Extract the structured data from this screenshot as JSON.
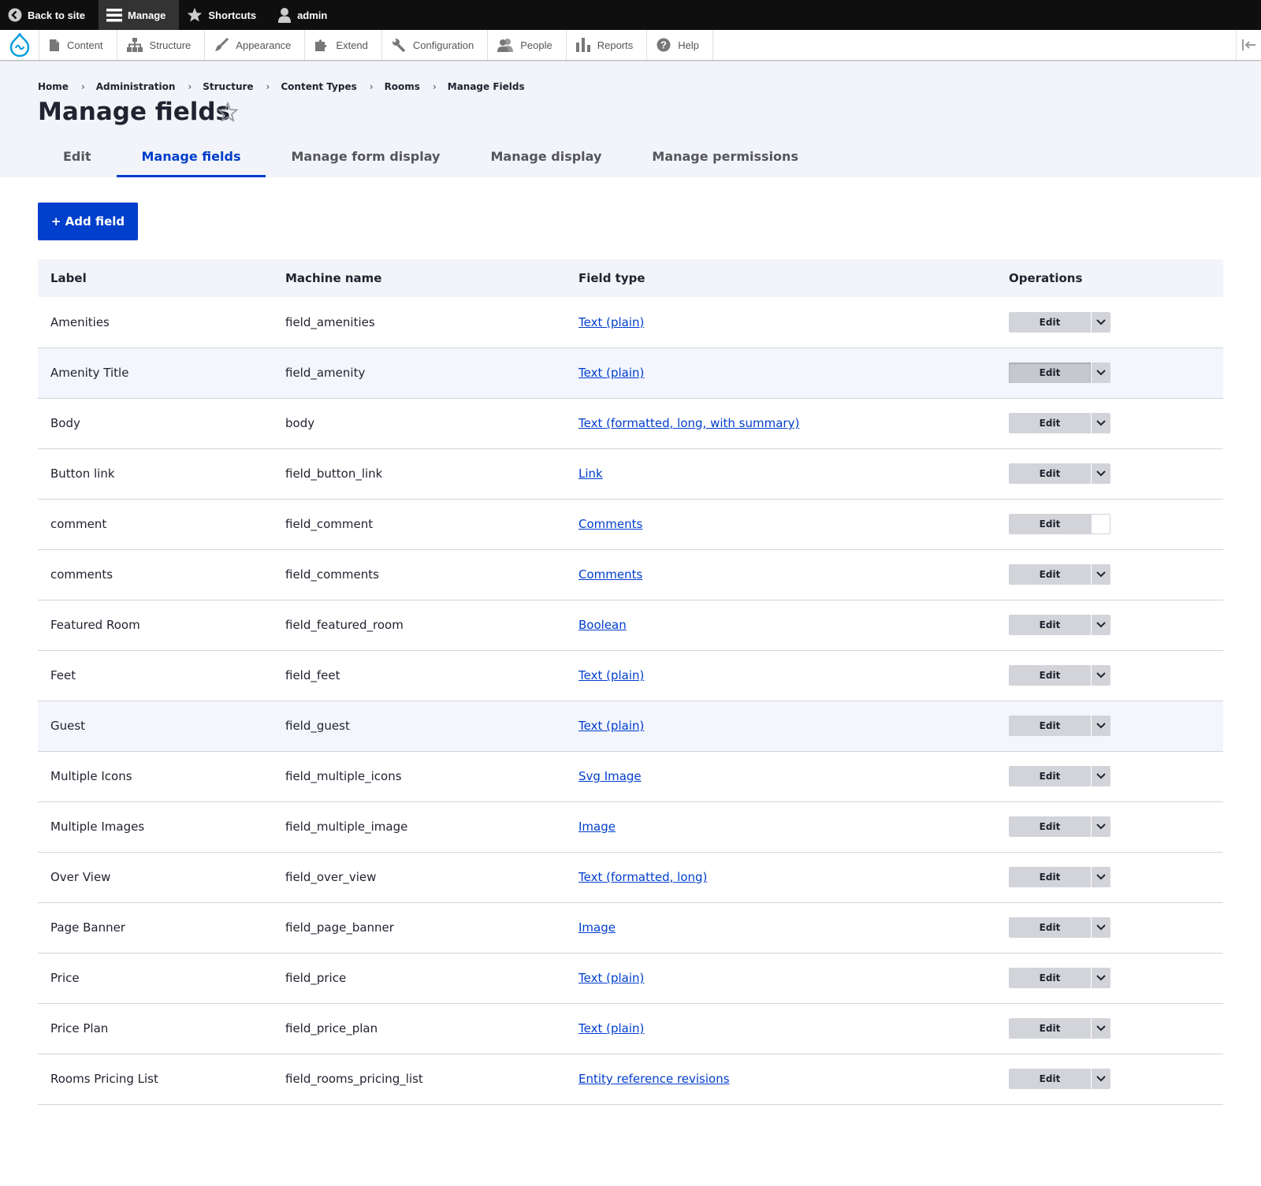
{
  "toolbar": {
    "back_to_site": "Back to site",
    "manage": "Manage",
    "shortcuts": "Shortcuts",
    "user": "admin"
  },
  "admin_menu": {
    "items": [
      {
        "label": "Content",
        "icon": "file-icon"
      },
      {
        "label": "Structure",
        "icon": "sitemap-icon"
      },
      {
        "label": "Appearance",
        "icon": "paintbrush-icon"
      },
      {
        "label": "Extend",
        "icon": "puzzle-icon"
      },
      {
        "label": "Configuration",
        "icon": "wrench-icon"
      },
      {
        "label": "People",
        "icon": "people-icon"
      },
      {
        "label": "Reports",
        "icon": "bar-chart-icon"
      },
      {
        "label": "Help",
        "icon": "help-icon"
      }
    ]
  },
  "breadcrumb": [
    "Home",
    "Administration",
    "Structure",
    "Content Types",
    "Rooms",
    "Manage Fields"
  ],
  "page_title": "Manage fields",
  "tabs": [
    "Edit",
    "Manage fields",
    "Manage form display",
    "Manage display",
    "Manage permissions"
  ],
  "active_tab": "Manage fields",
  "add_field_label": "+ Add field",
  "table": {
    "headers": {
      "label": "Label",
      "machine": "Machine name",
      "type": "Field type",
      "ops": "Operations"
    },
    "edit_label": "Edit",
    "rows": [
      {
        "label": "Amenities",
        "machine": "field_amenities",
        "type": "Text (plain)"
      },
      {
        "label": "Amenity Title",
        "machine": "field_amenity",
        "type": "Text (plain)"
      },
      {
        "label": "Body",
        "machine": "body",
        "type": "Text (formatted, long, with summary)"
      },
      {
        "label": "Button link",
        "machine": "field_button_link",
        "type": "Link"
      },
      {
        "label": "comment",
        "machine": "field_comment",
        "type": "Comments"
      },
      {
        "label": "comments",
        "machine": "field_comments",
        "type": "Comments"
      },
      {
        "label": "Featured Room",
        "machine": "field_featured_room",
        "type": "Boolean"
      },
      {
        "label": "Feet",
        "machine": "field_feet",
        "type": "Text (plain)"
      },
      {
        "label": "Guest",
        "machine": "field_guest",
        "type": "Text (plain)"
      },
      {
        "label": "Multiple Icons",
        "machine": "field_multiple_icons",
        "type": "Svg Image"
      },
      {
        "label": "Multiple Images",
        "machine": "field_multiple_image",
        "type": "Image"
      },
      {
        "label": "Over View",
        "machine": "field_over_view",
        "type": "Text (formatted, long)"
      },
      {
        "label": "Page Banner",
        "machine": "field_page_banner",
        "type": "Image"
      },
      {
        "label": "Price",
        "machine": "field_price",
        "type": "Text (plain)"
      },
      {
        "label": "Price Plan",
        "machine": "field_price_plan",
        "type": "Text (plain)"
      },
      {
        "label": "Rooms Pricing List",
        "machine": "field_rooms_pricing_list",
        "type": "Entity reference revisions"
      }
    ]
  },
  "colors": {
    "accent": "#003ecc",
    "toolbar_bg": "#0f0f0f",
    "header_bg": "#f3f4f9",
    "button_grey": "#d3d4d9"
  }
}
